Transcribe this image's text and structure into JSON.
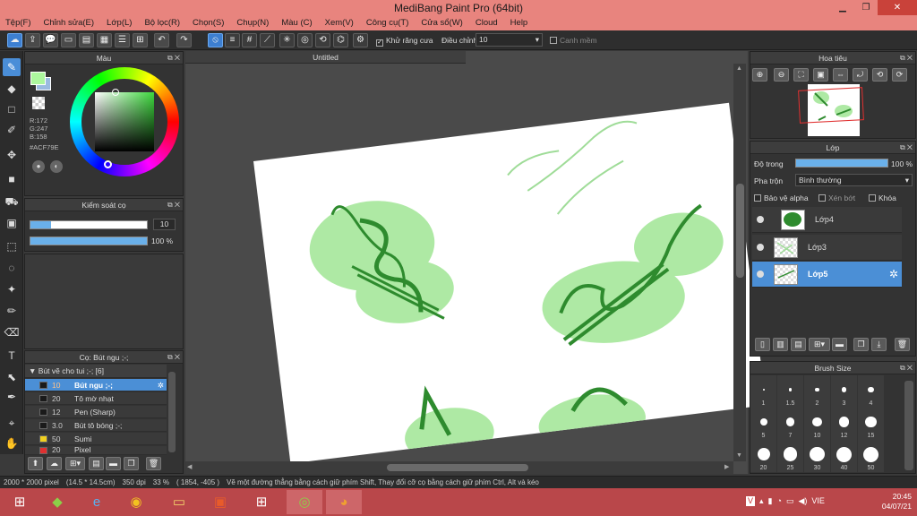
{
  "window": {
    "title": "MediBang Paint Pro (64bit)"
  },
  "menu": [
    "Tệp(F)",
    "Chỉnh sửa(E)",
    "Lớp(L)",
    "Bộ lọc(R)",
    "Chọn(S)",
    "Chụp(N)",
    "Màu (C)",
    "Xem(V)",
    "Công cụ(T)",
    "Cửa sổ(W)",
    "Cloud",
    "Help"
  ],
  "toolbar": {
    "antialias_label": "Khử răng cưa",
    "stabilizer_label": "Điều chỉnh",
    "stabilizer_value": "10",
    "snap_label": "Canh mềm"
  },
  "document": {
    "tab_title": "Untitled"
  },
  "color_panel": {
    "title": "Màu",
    "r": "R:172",
    "g": "G:247",
    "b": "B:158",
    "hex": "#ACF79E",
    "fg_color": "#ACF79E",
    "bg_color": "#9bbbe0"
  },
  "brush_control": {
    "title": "Kiểm soát cọ",
    "size": "10",
    "opacity": "100 %",
    "size_fraction": 0.18,
    "opacity_fraction": 1.0
  },
  "brush_panel": {
    "title": "Cọ: Bút ngu ;-;",
    "group": "Bút vẽ cho tui ;-; [6]",
    "items": [
      {
        "size": "10",
        "name": "Bút ngu ;-;",
        "color": "#111111",
        "selected": true
      },
      {
        "size": "20",
        "name": "Tô mờ nhạt",
        "color": "#111111"
      },
      {
        "size": "12",
        "name": "Pen (Sharp)",
        "color": "#111111"
      },
      {
        "size": "3.0",
        "name": "Bút tô bóng ;-;",
        "color": "#111111"
      },
      {
        "size": "50",
        "name": "Sumi",
        "color": "#f0d020"
      },
      {
        "size": "20",
        "name": "Pixel",
        "color": "#e03030"
      }
    ]
  },
  "navigator": {
    "title": "Hoa tiêu"
  },
  "layers": {
    "title": "Lớp",
    "opacity_label": "Độ trong",
    "opacity_value": "100 %",
    "opacity_fraction": 1.0,
    "blend_label": "Pha trộn",
    "blend_value": "Bình thường",
    "protect_alpha": "Bảo vệ alpha",
    "clipping": "Xén bớt",
    "lock": "Khóa",
    "items": [
      {
        "name": "Lớp4"
      },
      {
        "name": "Lớp3"
      },
      {
        "name": "Lớp5",
        "selected": true
      }
    ]
  },
  "brush_size": {
    "title": "Brush Size",
    "values": [
      "1",
      "1.5",
      "2",
      "3",
      "4",
      "5",
      "7",
      "10",
      "12",
      "15",
      "20",
      "25",
      "30",
      "40",
      "50"
    ]
  },
  "status": {
    "dims": "2000 * 2000 pixel",
    "physical": "(14.5 * 14.5cm)",
    "dpi": "350 dpi",
    "zoom": "33 %",
    "coords": "( 1854, -405 )",
    "hint": "Vẽ một đường thẳng bằng cách giữ phím Shift, Thay đổi cỡ cọ bằng cách giữ phím Ctrl, Alt và kéo"
  },
  "taskbar": {
    "time": "20:45",
    "date": "04/07/21",
    "lang": "VIE"
  }
}
